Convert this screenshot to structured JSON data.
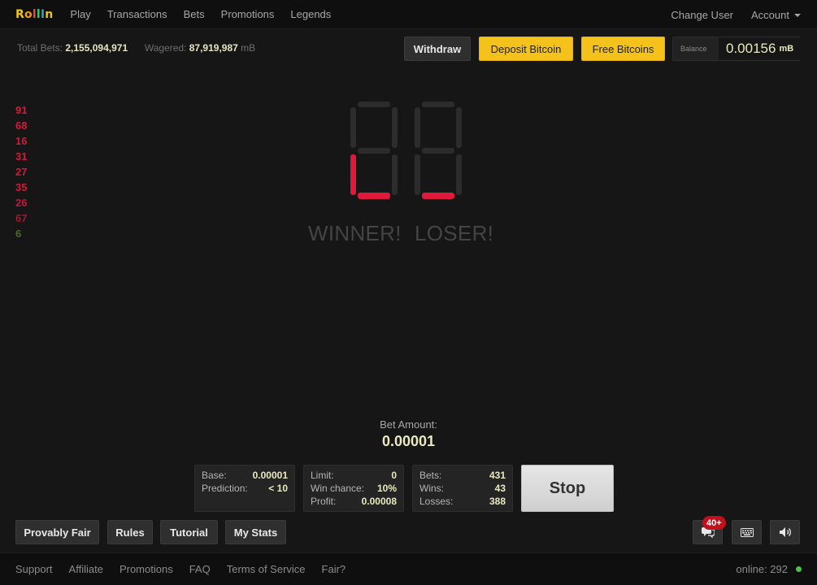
{
  "app": {
    "logo_letters": [
      "R",
      "o",
      "l",
      "l",
      "I",
      "n"
    ]
  },
  "nav": {
    "items": [
      "Play",
      "Transactions",
      "Bets",
      "Promotions",
      "Legends"
    ],
    "change_user": "Change User",
    "account": "Account"
  },
  "stats": {
    "total_bets_label": "Total Bets:",
    "total_bets": "2,155,094,971",
    "wagered_label": "Wagered:",
    "wagered": "87,919,987",
    "wagered_unit": "mB"
  },
  "actions": {
    "withdraw": "Withdraw",
    "deposit": "Deposit Bitcoin",
    "free": "Free Bitcoins"
  },
  "balance": {
    "label": "Balance",
    "value": "0.00156",
    "unit": "mB"
  },
  "history": [
    {
      "value": "91",
      "color": "#d11a3a"
    },
    {
      "value": "68",
      "color": "#d11a3a"
    },
    {
      "value": "16",
      "color": "#d11a3a"
    },
    {
      "value": "31",
      "color": "#d11a3a"
    },
    {
      "value": "27",
      "color": "#d11a3a"
    },
    {
      "value": "35",
      "color": "#d11a3a"
    },
    {
      "value": "26",
      "color": "#c8143a"
    },
    {
      "value": "67",
      "color": "#9a1a30"
    },
    {
      "value": "6",
      "color": "#4a6a2a"
    }
  ],
  "display": {
    "winner": "WINNER!",
    "loser": "LOSER!",
    "active_color": "#e0183c",
    "inactive_color": "#2c2c2c"
  },
  "bet": {
    "label": "Bet Amount:",
    "value": "0.00001"
  },
  "panel_base": {
    "base_label": "Base:",
    "base": "0.00001",
    "prediction_label": "Prediction:",
    "prediction": "< 10"
  },
  "panel_limit": {
    "limit_label": "Limit:",
    "limit": "0",
    "win_chance_label": "Win chance:",
    "win_chance": "10%",
    "profit_label": "Profit:",
    "profit": "0.00008"
  },
  "panel_stats": {
    "bets_label": "Bets:",
    "bets": "431",
    "wins_label": "Wins:",
    "wins": "43",
    "losses_label": "Losses:",
    "losses": "388"
  },
  "stop": "Stop",
  "bottom": {
    "provably_fair": "Provably Fair",
    "rules": "Rules",
    "tutorial": "Tutorial",
    "my_stats": "My Stats",
    "chat_badge": "40+"
  },
  "footer": {
    "links": [
      "Support",
      "Affiliate",
      "Promotions",
      "FAQ",
      "Terms of Service",
      "Fair?"
    ],
    "online": "online: 292"
  }
}
